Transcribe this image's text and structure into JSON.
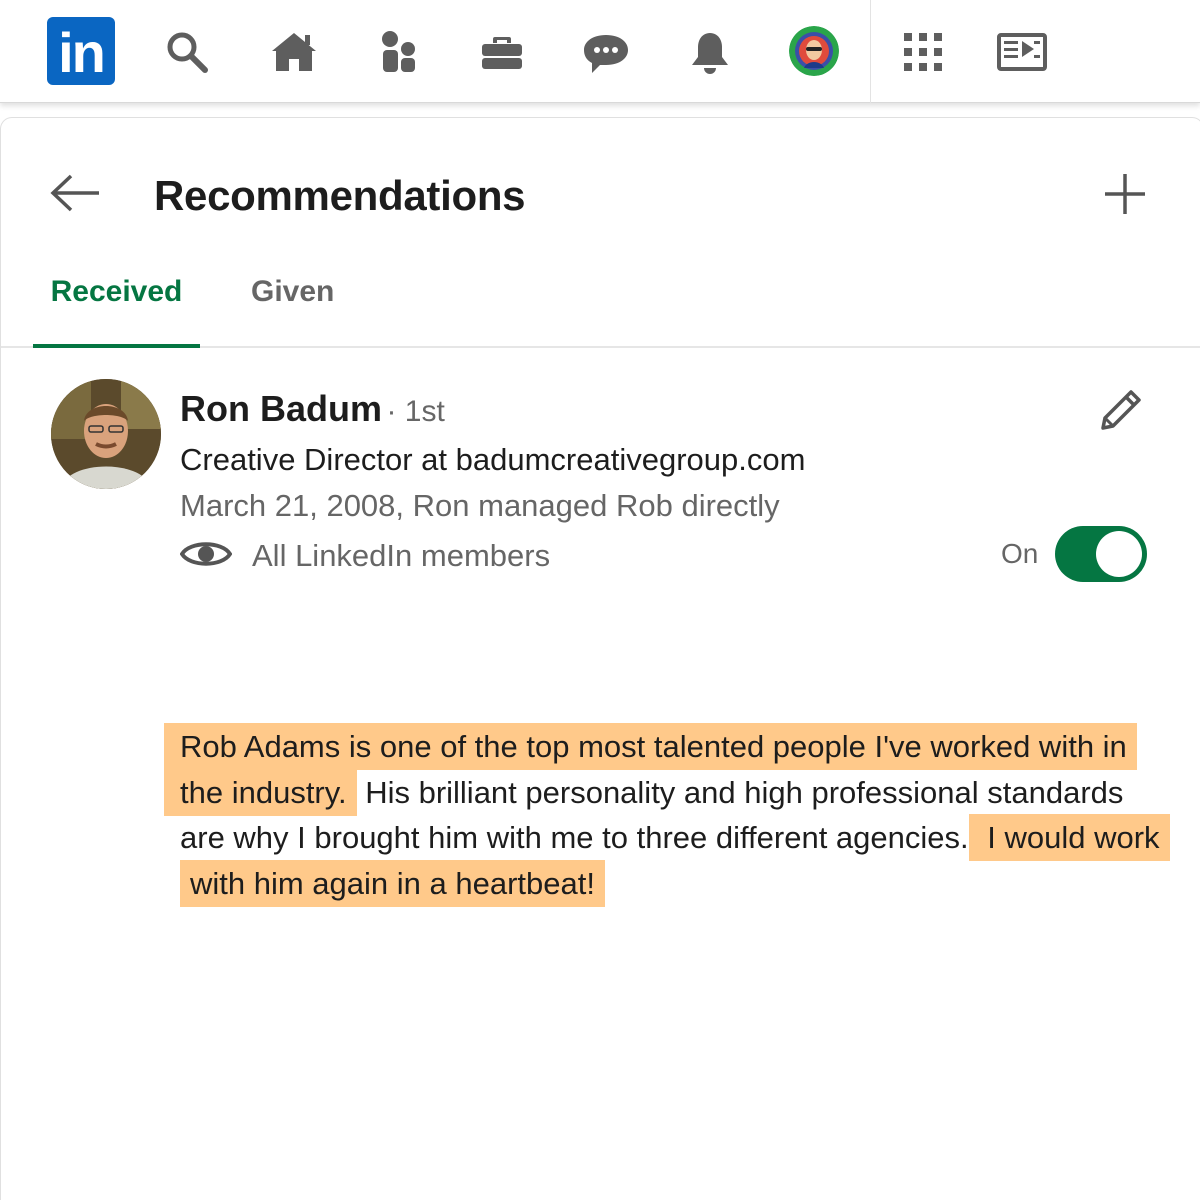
{
  "nav": {
    "logo_text": "in",
    "icons": [
      "search-icon",
      "home-icon",
      "my-network-icon",
      "jobs-icon",
      "messaging-icon",
      "notifications-icon",
      "me-avatar",
      "work-grid-icon",
      "learning-icon"
    ]
  },
  "page": {
    "title": "Recommendations",
    "tabs": [
      {
        "label": "Received",
        "active": true
      },
      {
        "label": "Given",
        "active": false
      }
    ]
  },
  "recommendation": {
    "name": "Ron Badum",
    "degree": "· 1st",
    "headline": "Creative Director at badumcreativegroup.com",
    "meta": "March 21, 2008, Ron managed Rob directly",
    "visibility": "All LinkedIn members",
    "toggle_label": "On",
    "toggle_on": true,
    "text": {
      "part1": "Rob Adams is one of the top most talented people I've worked with in the industry.",
      "part2": " His brilliant personality and high professional standards are why I brought him with me to three different agencies.",
      "part3": " I would work with him again in a heartbeat!"
    }
  },
  "colors": {
    "brand": "#0a66c2",
    "accent_green": "#057642",
    "highlight": "#ffc98a",
    "icon_gray": "#666666"
  }
}
